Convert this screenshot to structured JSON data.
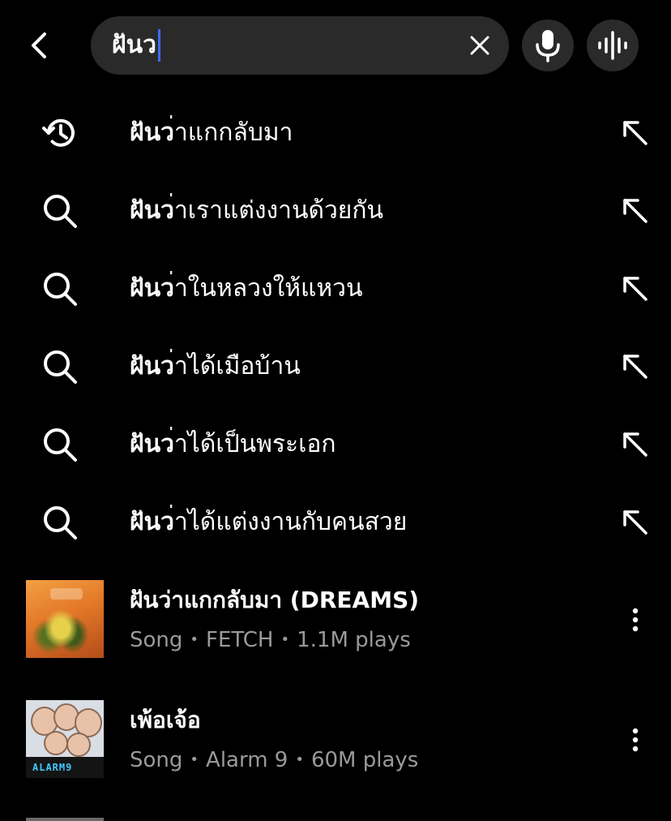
{
  "search": {
    "query": "ฝันว",
    "caret_color": "#3d6bff"
  },
  "icons": {
    "back": "back-arrow-icon",
    "clear": "close-icon",
    "mic": "microphone-icon",
    "song_search": "audio-wave-icon",
    "history": "history-icon",
    "search": "search-icon",
    "fill": "arrow-up-left-icon",
    "more": "more-vertical-icon"
  },
  "suggestions": [
    {
      "type": "history",
      "bold": "ฝันว",
      "rest": "่าแกกลับมา"
    },
    {
      "type": "search",
      "bold": "ฝันว",
      "rest": "่าเราแต่งงานด้วยกัน"
    },
    {
      "type": "search",
      "bold": "ฝันว",
      "rest": "่าในหลวงให้แหวน"
    },
    {
      "type": "search",
      "bold": "ฝันว",
      "rest": "่าได้เมือบ้าน"
    },
    {
      "type": "search",
      "bold": "ฝันว",
      "rest": "่าได้เป็นพระเอก"
    },
    {
      "type": "search",
      "bold": "ฝันว",
      "rest": "่าได้แต่งงานกับคนสวย"
    }
  ],
  "songs": [
    {
      "title": "ฝันว่าแกกลับมา (DREAMS)",
      "type": "Song",
      "artist": "FETCH",
      "plays": "1.1M plays"
    },
    {
      "title": "เพ้อเจ้อ",
      "type": "Song",
      "artist": "Alarm 9",
      "plays": "60M plays",
      "cover_text": "ALARM9"
    }
  ],
  "separator": "•"
}
